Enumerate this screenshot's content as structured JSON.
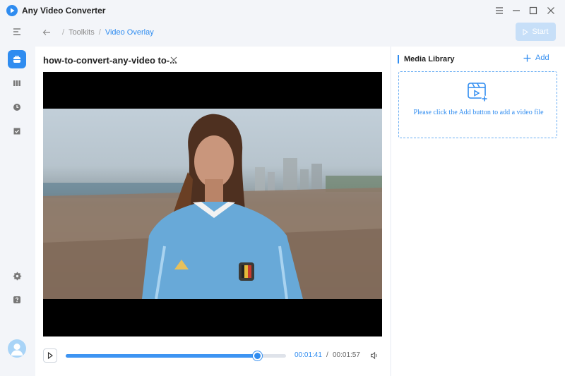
{
  "app": {
    "title": "Any Video Converter"
  },
  "breadcrumb": {
    "items": [
      "Toolkits",
      "Video Overlay"
    ],
    "separator": "/"
  },
  "toolbar": {
    "start_label": "Start"
  },
  "player": {
    "file_name": "how-to-convert-any-video to-...",
    "current_time": "00:01:41",
    "time_separator": "/",
    "total_time": "00:01:57",
    "progress": 0.87
  },
  "library": {
    "title": "Media Library",
    "add_label": "Add",
    "empty_message": "Please click the Add button to add a video file"
  },
  "sidebar": {
    "items": [
      "menu-icon",
      "toolkit-icon",
      "library-icon",
      "history-icon",
      "tasks-icon",
      "settings-icon",
      "help-icon",
      "avatar-icon"
    ]
  },
  "colors": {
    "accent": "#2f8cf0",
    "start_disabled": "#c7dff8",
    "background": "#f3f5f9"
  }
}
